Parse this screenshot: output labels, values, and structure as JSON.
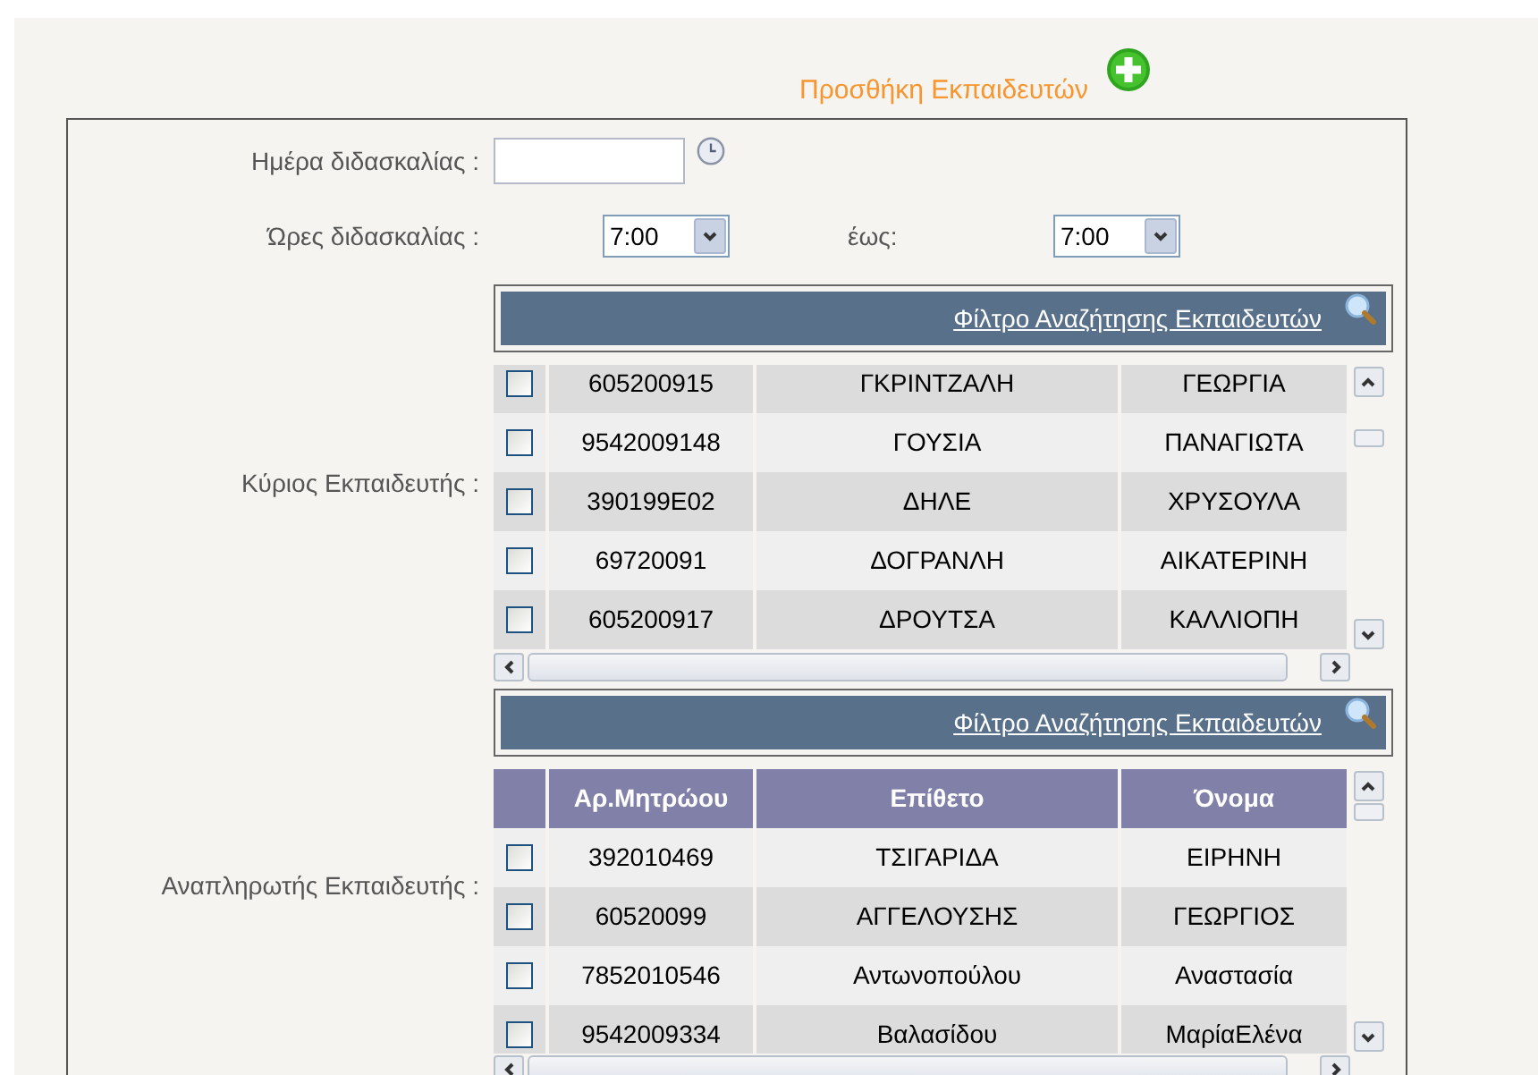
{
  "header": {
    "title": "Προσθήκη Εκπαιδευτών"
  },
  "day": {
    "label": "Ημέρα διδασκαλίας :"
  },
  "hours": {
    "label": "Ώρες διδασκαλίας :",
    "from": "7:00",
    "to_label": "έως:",
    "to": "7:00"
  },
  "grids": [
    {
      "label": "Κύριος Εκπαιδευτής :",
      "filter_link": "Φίλτρο Αναζήτησης Εκπαιδευτών",
      "rows": [
        {
          "id": "605200915",
          "surname": "ΓΚΡΙΝΤΖΑΛΗ",
          "name": "ΓΕΩΡΓΙΑ",
          "checked": false
        },
        {
          "id": "9542009148",
          "surname": "ΓΟΥΣΙΑ",
          "name": "ΠΑΝΑΓΙΩΤΑ",
          "checked": false
        },
        {
          "id": "390199E02",
          "surname": "ΔΗΛΕ",
          "name": "ΧΡΥΣΟΥΛΑ",
          "checked": false
        },
        {
          "id": "69720091",
          "surname": "ΔΟΓΡΑΝΛΗ",
          "name": "ΑΙΚΑΤΕΡΙΝΗ",
          "checked": false
        },
        {
          "id": "605200917",
          "surname": "ΔΡΟΥΤΣΑ",
          "name": "ΚΑΛΛΙΟΠΗ",
          "checked": false
        }
      ]
    },
    {
      "label": "Αναπληρωτής Εκπαιδευτής :",
      "filter_link": "Φίλτρο Αναζήτησης Εκπαιδευτών",
      "columns": [
        "Αρ.Μητρώου",
        "Επίθετο",
        "Όνομα"
      ],
      "rows": [
        {
          "id": "392010469",
          "surname": "ΤΣΙΓΑΡΙΔΑ",
          "name": "ΕΙΡΗΝΗ",
          "checked": false
        },
        {
          "id": "60520099",
          "surname": "ΑΓΓΕΛΟΥΣΗΣ",
          "name": "ΓΕΩΡΓΙΟΣ",
          "checked": false
        },
        {
          "id": "7852010546",
          "surname": "Αντωνοπούλου",
          "name": "Αναστασία",
          "checked": false
        },
        {
          "id": "9542009334",
          "surname": "Βαλασίδου",
          "name": "ΜαρίαΕλένα",
          "checked": false
        }
      ]
    }
  ]
}
